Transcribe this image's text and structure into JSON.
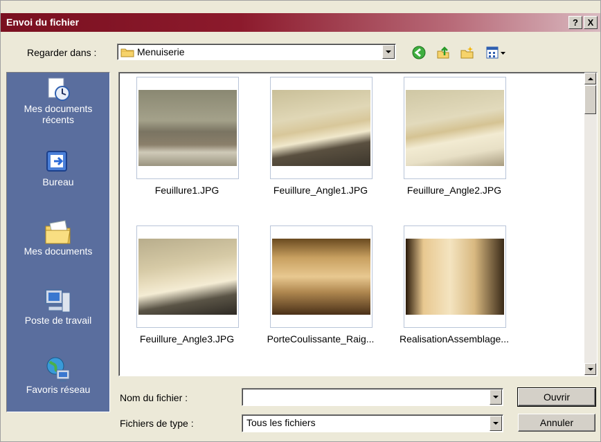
{
  "window": {
    "title": "Envoi du fichier",
    "help_label": "?",
    "close_label": "X"
  },
  "lookin": {
    "label": "Regarder dans :",
    "folder": "Menuiserie"
  },
  "toolbar": {
    "icons": [
      "back-icon",
      "up-folder-icon",
      "new-folder-icon",
      "view-menu-icon"
    ]
  },
  "places": [
    {
      "label_1": "Mes documents",
      "label_2": "récents",
      "icon": "recent-documents-icon"
    },
    {
      "label_1": "Bureau",
      "label_2": "",
      "icon": "desktop-icon"
    },
    {
      "label_1": "Mes documents",
      "label_2": "",
      "icon": "my-documents-icon"
    },
    {
      "label_1": "Poste de travail",
      "label_2": "",
      "icon": "my-computer-icon"
    },
    {
      "label_1": "Favoris réseau",
      "label_2": "",
      "icon": "network-places-icon"
    }
  ],
  "files": [
    {
      "name": "Feuillure1.JPG"
    },
    {
      "name": "Feuillure_Angle1.JPG"
    },
    {
      "name": "Feuillure_Angle2.JPG"
    },
    {
      "name": "Feuillure_Angle3.JPG"
    },
    {
      "name": "PorteCoulissante_Raig..."
    },
    {
      "name": "RealisationAssemblage..."
    }
  ],
  "filename": {
    "label": "Nom du fichier :",
    "value": ""
  },
  "filetype": {
    "label": "Fichiers de type :",
    "value": "Tous les fichiers"
  },
  "buttons": {
    "open": "Ouvrir",
    "cancel": "Annuler"
  }
}
